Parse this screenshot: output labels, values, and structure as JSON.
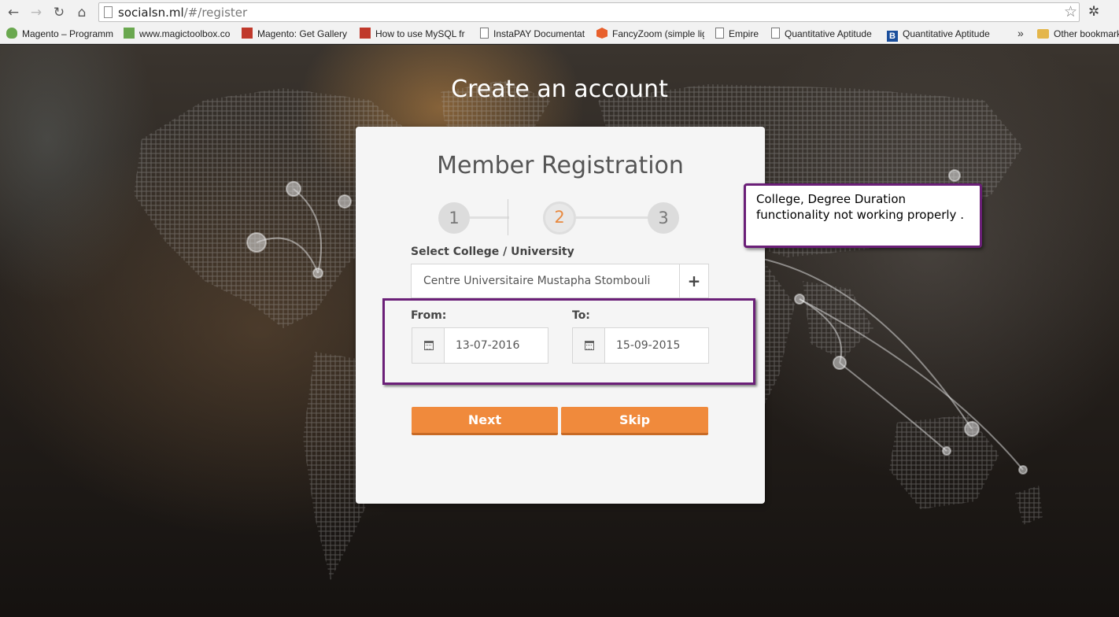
{
  "browser": {
    "url_host": "socialsn.ml",
    "url_path": "/#/register",
    "nav": {
      "back": "←",
      "forward": "→",
      "reload": "↻",
      "home": "⌂"
    },
    "bookmarks": [
      {
        "label": "Magento – Programm",
        "icon": "magento-g"
      },
      {
        "label": "www.magictoolbox.co",
        "icon": "green"
      },
      {
        "label": "Magento: Get Gallery",
        "icon": "red"
      },
      {
        "label": "How to use MySQL fr",
        "icon": "red"
      },
      {
        "label": "InstaPAY Documentat",
        "icon": "doc"
      },
      {
        "label": "FancyZoom (simple lig",
        "icon": "orange"
      },
      {
        "label": "Empire",
        "icon": "doc"
      },
      {
        "label": "Quantitative Aptitude",
        "icon": "doc"
      },
      {
        "label": "Quantitative Aptitude",
        "icon": "blue"
      }
    ],
    "overflow_chevron": "»",
    "other_bookmarks": "Other bookmarks"
  },
  "page": {
    "title": "Create an account"
  },
  "registration": {
    "title": "Member Registration",
    "steps": [
      "1",
      "2",
      "3"
    ],
    "active_step": "2",
    "college_label": "Select College / University",
    "college_value": "Centre Universitaire Mustapha Stombouli",
    "add_symbol": "+",
    "from_label": "From:",
    "from_value": "13-07-2016",
    "to_label": "To:",
    "to_value": "15-09-2015",
    "next_label": "Next",
    "skip_label": "Skip"
  },
  "annotation": {
    "note_line1": "College, Degree Duration",
    "note_line2": "functionality not working properly ."
  },
  "colors": {
    "accent": "#f08a3c",
    "annotation": "#6b1f78",
    "active_step": "#e8893f"
  }
}
